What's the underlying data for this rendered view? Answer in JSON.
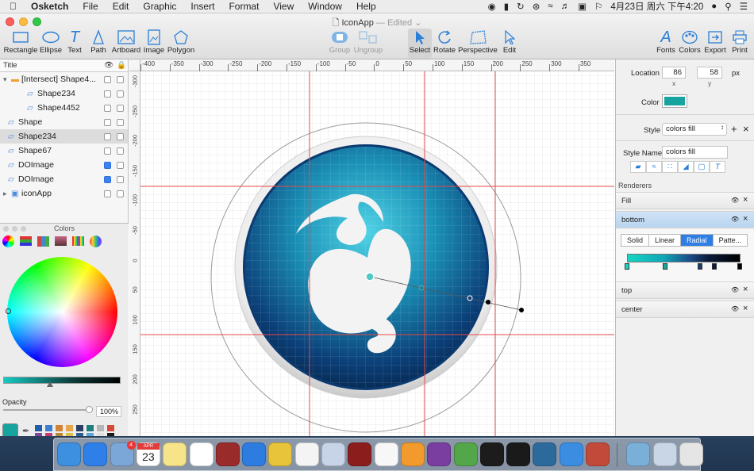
{
  "menubar": {
    "app_name": "Osketch",
    "menus": [
      "File",
      "Edit",
      "Graphic",
      "Insert",
      "Format",
      "View",
      "Window",
      "Help"
    ],
    "clock": "4月23日 周六 下午4:20"
  },
  "window": {
    "title": "IconApp",
    "status": "Edited"
  },
  "toolbar": {
    "rectangle": "Rectangle",
    "ellipse": "Ellipse",
    "text": "Text",
    "path": "Path",
    "artboard": "Artboard",
    "image": "Image",
    "polygon": "Polygon",
    "group": "Group",
    "ungroup": "Ungroup",
    "select": "Select",
    "rotate": "Rotate",
    "perspective": "Perspective",
    "edit": "Edit",
    "fonts": "Fonts",
    "colors": "Colors",
    "export": "Export",
    "print": "Print"
  },
  "layers": {
    "header": "Title",
    "items": [
      {
        "name": "[Intersect] Shape4...",
        "checked": false
      },
      {
        "name": "Shape234",
        "checked": false
      },
      {
        "name": "Shape4452",
        "checked": false
      },
      {
        "name": "Shape",
        "checked": false
      },
      {
        "name": "Shape234",
        "checked": false
      },
      {
        "name": "Shape67",
        "checked": false
      },
      {
        "name": "DOImage",
        "checked": true
      },
      {
        "name": "DOImage",
        "checked": true
      },
      {
        "name": "iconApp",
        "checked": false
      }
    ]
  },
  "colors_panel": {
    "title": "Colors",
    "opacity_label": "Opacity",
    "opacity_value": "100%",
    "current_color": "#17a3a0",
    "swatches": [
      "#1f5ea8",
      "#3b7fcf",
      "#d28436",
      "#e8a64b",
      "#2a3f63",
      "#1c7f7e",
      "#b6b6b6",
      "#d34a3a",
      "#7b4a9c",
      "#c43b74",
      "#b8862f",
      "#d9c14a",
      "#2c5f8f",
      "#5aa6d6",
      "#e0e0e0",
      "#1a1a1a"
    ]
  },
  "rulers": {
    "h": [
      "-400",
      "-350",
      "-300",
      "-250",
      "-200",
      "-150",
      "-100",
      "-50",
      "0",
      "50",
      "100",
      "150",
      "200",
      "250",
      "300",
      "350"
    ],
    "v": [
      "-300",
      "-250",
      "-200",
      "-150",
      "-100",
      "-50",
      "0",
      "50",
      "100",
      "150",
      "200",
      "250"
    ]
  },
  "inspector": {
    "location_label": "Location",
    "x_value": "86",
    "x_label": "x",
    "y_value": "58",
    "y_label": "y",
    "unit": "px",
    "color_label": "Color",
    "color_value": "#17a3a0",
    "style_label": "Style",
    "style_value": "colors fill",
    "style_name_label": "Style Name",
    "style_name_value": "colors fill",
    "renderers_label": "Renderers",
    "renderers": [
      {
        "name": "Fill"
      },
      {
        "name": "bottom"
      },
      {
        "name": "top"
      },
      {
        "name": "center"
      }
    ],
    "fill_tabs": [
      "Solid",
      "Linear",
      "Radial",
      "Patte..."
    ],
    "active_tab": "Radial"
  },
  "dock": {
    "apps": [
      "finder-icon",
      "app-store-icon",
      "preview-icon",
      "calendar-icon",
      "notes-icon",
      "reminders-icon",
      "dictionary-icon",
      "safari-icon",
      "banana-icon",
      "itunes-icon",
      "preview2-icon",
      "photo-booth-icon",
      "photos-icon",
      "ibooks-icon",
      "onenote-icon",
      "evernote-icon",
      "terminal-icon",
      "qq-icon",
      "sourcetree-icon",
      "xcode-icon",
      "sketch-icon",
      "pinyin-icon",
      "preview3-icon",
      "trash-icon"
    ],
    "calendar_day": "23",
    "calendar_month": "APR",
    "badge": "4"
  }
}
